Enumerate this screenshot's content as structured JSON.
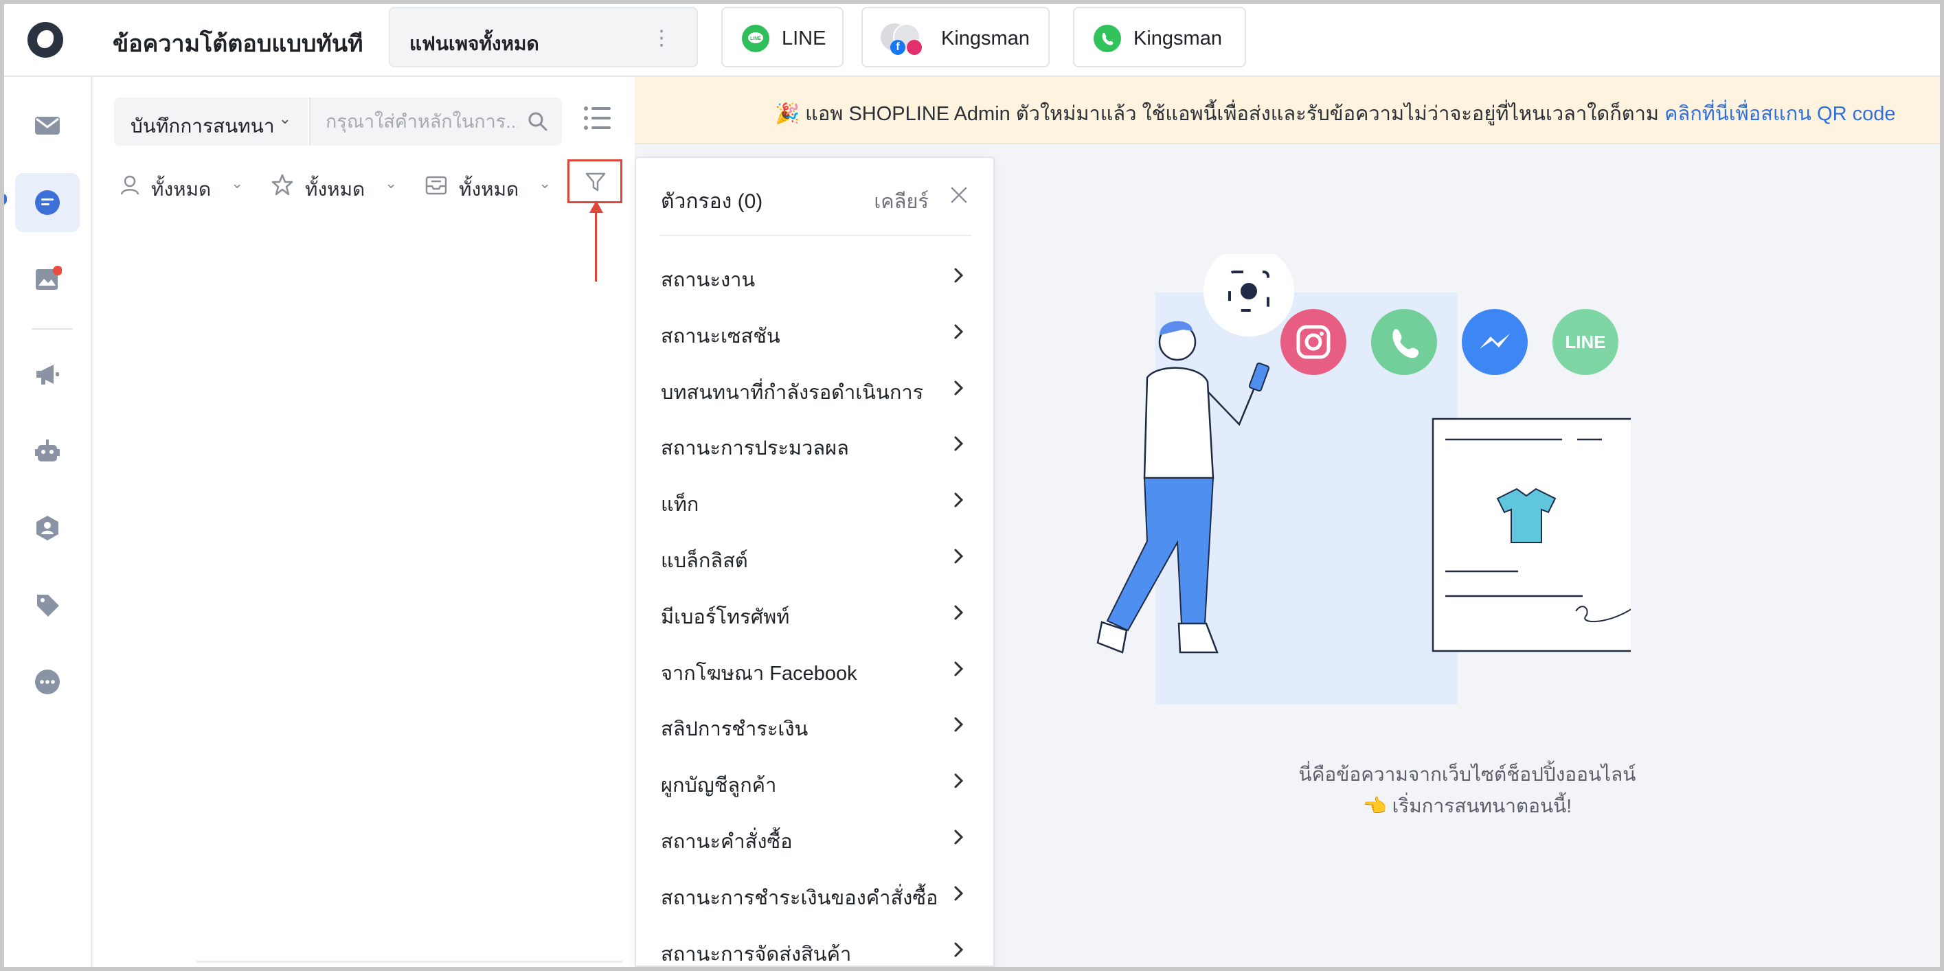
{
  "header": {
    "title": "ข้อความโต้ตอบแบบทันที",
    "page_selector": "แฟนเพจทั้งหมด",
    "channels": [
      {
        "label": "LINE",
        "icon": "line-icon"
      },
      {
        "label": "Kingsman",
        "icon": "facebook-instagram-avatar-icon"
      },
      {
        "label": "Kingsman",
        "icon": "whatsapp-icon"
      }
    ]
  },
  "rail": {
    "items": [
      "inbox-icon",
      "chat-icon",
      "gallery-icon",
      "megaphone-icon",
      "bot-icon",
      "contacts-icon",
      "tags-icon",
      "more-icon"
    ]
  },
  "list_panel": {
    "conversation_select": "บันทึกการสนทนา",
    "search_placeholder": "กรุณาใส่คำหลักในการ...",
    "filters": [
      {
        "label": "ทั้งหมด",
        "icon": "user-icon"
      },
      {
        "label": "ทั้งหมด",
        "icon": "star-icon"
      },
      {
        "label": "ทั้งหมด",
        "icon": "inbox-tray-icon"
      }
    ]
  },
  "banner": {
    "emoji": "🎉",
    "message": "แอพ SHOPLINE Admin ตัวใหม่มาแล้ว ใช้แอพนี้เพื่อส่งและรับข้อความไม่ว่าจะอยู่ที่ไหนเวลาใดก็ตาม",
    "link": "คลิกที่นี่เพื่อสแกน QR code"
  },
  "filter_popover": {
    "title": "ตัวกรอง (0)",
    "clear": "เคลียร์",
    "items": [
      "สถานะงาน",
      "สถานะเซสชัน",
      "บทสนทนาที่กำลังรอดำเนินการ",
      "สถานะการประมวลผล",
      "แท็ก",
      "แบล็กลิสต์",
      "มีเบอร์โทรศัพท์",
      "จากโฆษณา Facebook",
      "สลิปการชำระเงิน",
      "ผูกบัญชีลูกค้า",
      "สถานะคำสั่งซื้อ",
      "สถานะการชำระเงินของคำสั่งซื้อ",
      "สถานะการจัดส่งสินค้า"
    ]
  },
  "empty_state": {
    "line1": "นี่คือข้อความจากเว็บไซต์ช็อปปิ้งออนไลน์",
    "line2": "👈 เริ่มการสนทนาตอนนี้!",
    "social_icons": [
      "instagram-icon",
      "whatsapp-icon",
      "messenger-icon",
      "line-icon"
    ]
  },
  "colors": {
    "accent": "#3d6fd9",
    "highlight": "#e0453a",
    "banner_bg": "#fdf3df",
    "link": "#2f6fe0"
  }
}
